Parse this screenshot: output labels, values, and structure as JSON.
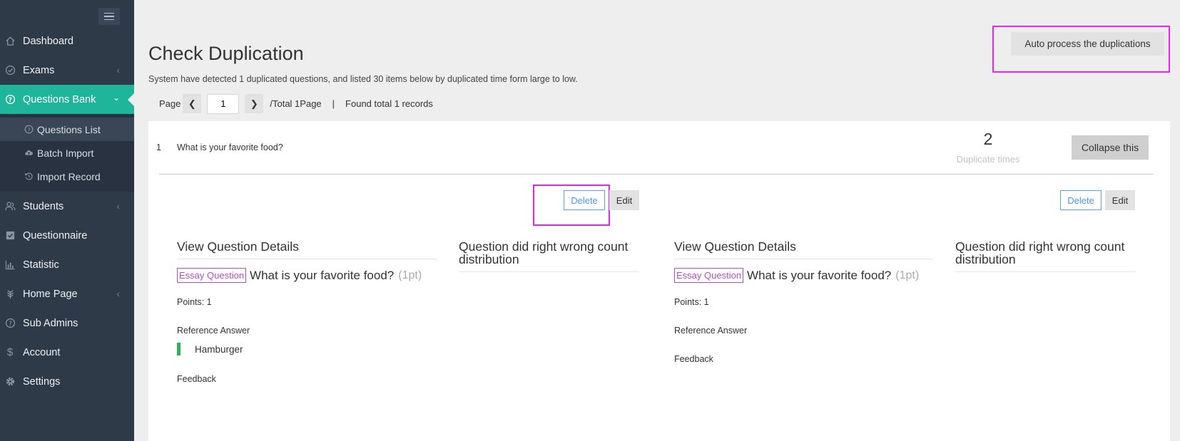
{
  "sidebar": {
    "items": [
      {
        "label": "Dashboard",
        "icon": "home-icon"
      },
      {
        "label": "Exams",
        "icon": "check-circle-icon"
      },
      {
        "label": "Questions Bank",
        "icon": "question-circle-icon"
      },
      {
        "label": "Students",
        "icon": "users-icon"
      },
      {
        "label": "Questionnaire",
        "icon": "checkbox-icon"
      },
      {
        "label": "Statistic",
        "icon": "bar-chart-icon"
      },
      {
        "label": "Home Page",
        "icon": "leaf-icon"
      },
      {
        "label": "Sub Admins",
        "icon": "question-circle-icon"
      },
      {
        "label": "Account",
        "icon": "dollar-icon"
      },
      {
        "label": "Settings",
        "icon": "gear-icon"
      }
    ],
    "sub_items": [
      {
        "label": "Questions List",
        "icon": "question-circle-icon"
      },
      {
        "label": "Batch Import",
        "icon": "cloud-upload-icon"
      },
      {
        "label": "Import Record",
        "icon": "history-icon"
      }
    ],
    "accent": "#1fb59b"
  },
  "page": {
    "title": "Check Duplication",
    "subtitle": "System have detected 1 duplicated questions, and listed 30 items below by duplicated time form large to low.",
    "auto_button": "Auto process the duplications"
  },
  "pager": {
    "page_label": "Page",
    "current": "1",
    "total": "/Total 1Page",
    "sep": "|",
    "found": "Found total 1 records"
  },
  "group": {
    "index": "1",
    "question": "What is your favorite food?",
    "dup_count": "2",
    "dup_label": "Duplicate times",
    "collapse_label": "Collapse this"
  },
  "cards": [
    {
      "delete_label": "Delete",
      "edit_label": "Edit",
      "details_head": "View Question Details",
      "dist_head": "Question did right wrong count distribution",
      "type_tag": "Essay Question",
      "title": "What is your favorite food?",
      "points_tag": "(1pt)",
      "points": "Points: 1",
      "ref_label": "Reference Answer",
      "answer": "Hamburger",
      "feedback_label": "Feedback"
    },
    {
      "delete_label": "Delete",
      "edit_label": "Edit",
      "details_head": "View Question Details",
      "dist_head": "Question did right wrong count distribution",
      "type_tag": "Essay Question",
      "title": "What is your favorite food?",
      "points_tag": "(1pt)",
      "points": "Points: 1",
      "ref_label": "Reference Answer",
      "feedback_label": "Feedback"
    }
  ]
}
